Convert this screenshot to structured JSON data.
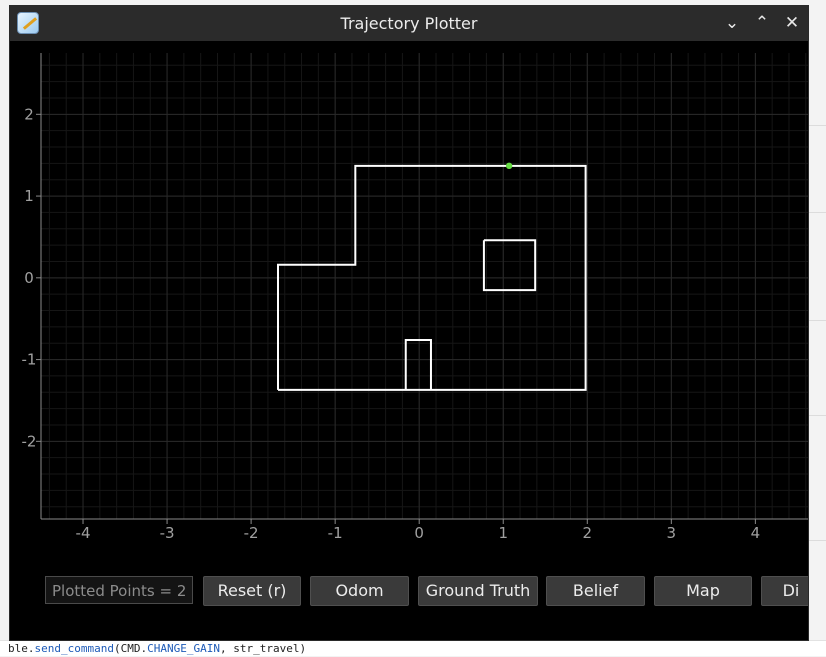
{
  "window": {
    "title": "Trajectory Plotter",
    "icon": "app-icon",
    "controls": [
      "minimize-icon",
      "maximize-icon",
      "close-icon"
    ]
  },
  "chart_data": {
    "type": "line",
    "title": "",
    "xlabel": "",
    "ylabel": "",
    "xlim": [
      -4.5,
      4.65
    ],
    "ylim": [
      -2.95,
      2.75
    ],
    "xticks": [
      -4,
      -3,
      -2,
      -1,
      0,
      1,
      2,
      3,
      4
    ],
    "yticks": [
      2,
      1,
      0,
      -1,
      -2
    ],
    "grid": true,
    "background": "#000000",
    "grid_color": "#2a2a2a",
    "series": [
      {
        "points": [
          [
            -1.68,
            -1.37
          ],
          [
            -1.68,
            0.16
          ],
          [
            -0.76,
            0.16
          ],
          [
            -0.76,
            1.37
          ],
          [
            1.98,
            1.37
          ],
          [
            1.98,
            -1.37
          ],
          [
            -1.68,
            -1.37
          ]
        ],
        "color": "#ffffff"
      },
      {
        "points": [
          [
            0.77,
            0.46
          ],
          [
            1.38,
            0.46
          ],
          [
            1.38,
            -0.15
          ],
          [
            0.77,
            -0.15
          ],
          [
            0.77,
            0.46
          ]
        ],
        "color": "#ffffff"
      },
      {
        "points": [
          [
            -0.16,
            -1.37
          ],
          [
            -0.16,
            -0.76
          ],
          [
            0.14,
            -0.76
          ],
          [
            0.14,
            -1.37
          ]
        ],
        "color": "#ffffff"
      }
    ],
    "points": [
      {
        "x": 1.07,
        "y": 1.37,
        "color": "#66dd44"
      }
    ]
  },
  "controls": {
    "counter_text": "Plotted Points = 2",
    "buttons": [
      {
        "label": "Reset (r)",
        "name": "reset-button"
      },
      {
        "label": "Odom",
        "name": "odom-button"
      },
      {
        "label": "Ground Truth",
        "name": "ground-truth-button"
      },
      {
        "label": "Belief",
        "name": "belief-button"
      },
      {
        "label": "Map",
        "name": "map-button"
      },
      {
        "label": "Di",
        "name": "distribution-button"
      }
    ]
  },
  "code_line": {
    "prefix": "ble.",
    "fn": "send_command",
    "middle": "(CMD.",
    "const": "CHANGE_GAIN",
    "suffix": ", str_travel)"
  }
}
